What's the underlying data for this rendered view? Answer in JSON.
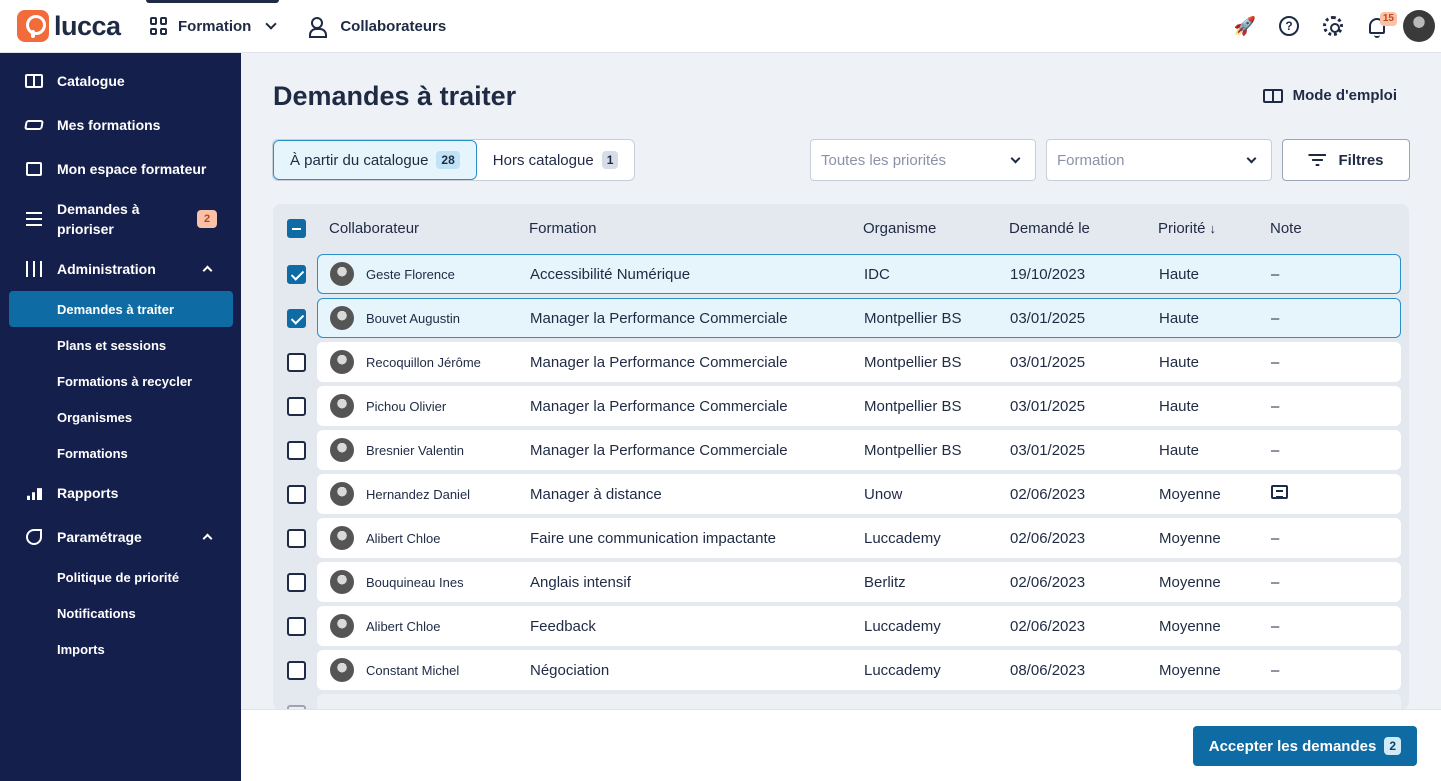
{
  "topbar": {
    "logo_text": "lucca",
    "app_name": "Formation",
    "collaborateurs": "Collaborateurs",
    "notif_count": "15",
    "help_glyph": "?",
    "icons": [
      "rocket-icon",
      "help-icon",
      "gear-icon",
      "bell-icon"
    ]
  },
  "sidebar": {
    "catalogue": "Catalogue",
    "mes_formations": "Mes formations",
    "espace_formateur": "Mon espace formateur",
    "demandes_prioriser": "Demandes à prioriser",
    "demandes_prioriser_count": "2",
    "administration": "Administration",
    "admin_items": [
      "Demandes à traiter",
      "Plans et sessions",
      "Formations à recycler",
      "Organismes",
      "Formations"
    ],
    "rapports": "Rapports",
    "parametrage": "Paramétrage",
    "param_items": [
      "Politique de priorité",
      "Notifications",
      "Imports"
    ]
  },
  "main": {
    "title": "Demandes à traiter",
    "manual": "Mode d'emploi",
    "tabs": [
      {
        "label": "À partir du catalogue",
        "count": "28",
        "active": true
      },
      {
        "label": "Hors catalogue",
        "count": "1",
        "active": false
      }
    ],
    "priority_placeholder": "Toutes les priorités",
    "formation_placeholder": "Formation",
    "filters_label": "Filtres"
  },
  "table": {
    "headers": {
      "collab": "Collaborateur",
      "formation": "Formation",
      "organisme": "Organisme",
      "date": "Demandé le",
      "priorite": "Priorité",
      "sort": "↓",
      "note": "Note"
    },
    "rows": [
      {
        "collab": "Geste Florence",
        "formation": "Accessibilité Numérique",
        "organisme": "IDC",
        "date": "19/10/2023",
        "priorite": "Haute",
        "note": "–",
        "selected": true
      },
      {
        "collab": "Bouvet Augustin",
        "formation": "Manager la Performance Commerciale",
        "organisme": "Montpellier BS",
        "date": "03/01/2025",
        "priorite": "Haute",
        "note": "–",
        "selected": true
      },
      {
        "collab": "Recoquillon Jérôme",
        "formation": "Manager la Performance Commerciale",
        "organisme": "Montpellier BS",
        "date": "03/01/2025",
        "priorite": "Haute",
        "note": "–",
        "selected": false
      },
      {
        "collab": "Pichou Olivier",
        "formation": "Manager la Performance Commerciale",
        "organisme": "Montpellier BS",
        "date": "03/01/2025",
        "priorite": "Haute",
        "note": "–",
        "selected": false
      },
      {
        "collab": "Bresnier Valentin",
        "formation": "Manager la Performance Commerciale",
        "organisme": "Montpellier BS",
        "date": "03/01/2025",
        "priorite": "Haute",
        "note": "–",
        "selected": false
      },
      {
        "collab": "Hernandez Daniel",
        "formation": "Manager à distance",
        "organisme": "Unow",
        "date": "02/06/2023",
        "priorite": "Moyenne",
        "note": "",
        "has_note_icon": true,
        "selected": false
      },
      {
        "collab": "Alibert Chloe",
        "formation": "Faire une communication impactante",
        "organisme": "Luccademy",
        "date": "02/06/2023",
        "priorite": "Moyenne",
        "note": "–",
        "selected": false
      },
      {
        "collab": "Bouquineau Ines",
        "formation": "Anglais intensif",
        "organisme": "Berlitz",
        "date": "02/06/2023",
        "priorite": "Moyenne",
        "note": "–",
        "selected": false
      },
      {
        "collab": "Alibert Chloe",
        "formation": "Feedback",
        "organisme": "Luccademy",
        "date": "02/06/2023",
        "priorite": "Moyenne",
        "note": "–",
        "selected": false
      },
      {
        "collab": "Constant Michel",
        "formation": "Négociation",
        "organisme": "Luccademy",
        "date": "08/06/2023",
        "priorite": "Moyenne",
        "note": "–",
        "selected": false
      }
    ]
  },
  "footer": {
    "accept_label": "Accepter les demandes",
    "accept_count": "2"
  }
}
